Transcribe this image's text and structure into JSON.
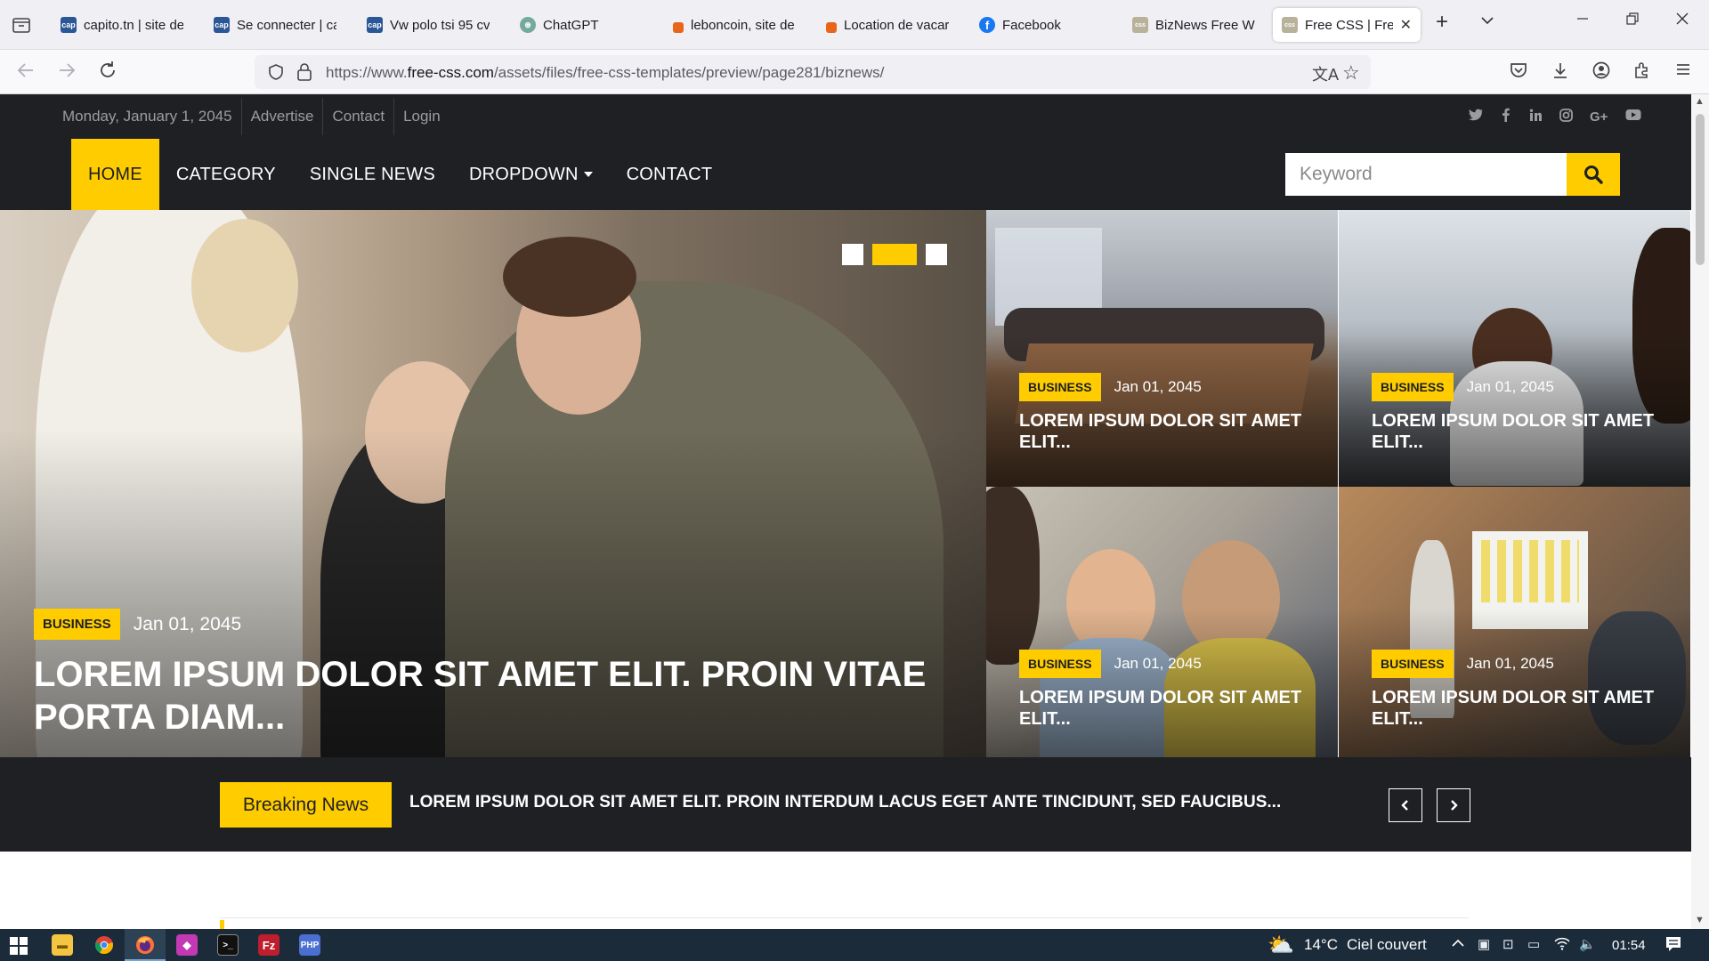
{
  "browser": {
    "tabs": [
      {
        "label": "capito.tn | site de",
        "favicon_color": "#2b5797",
        "favicon_text": "cap"
      },
      {
        "label": "Se connecter | cap",
        "favicon_color": "#2b5797",
        "favicon_text": "cap"
      },
      {
        "label": "Vw polo tsi 95 cv",
        "favicon_color": "#2b5797",
        "favicon_text": "cap"
      },
      {
        "label": "ChatGPT",
        "favicon_color": "#74aa9c",
        "favicon_text": "⊛"
      },
      {
        "label": "leboncoin, site de",
        "favicon_color": "#e8651a",
        "favicon_text": ""
      },
      {
        "label": "Location de vacar",
        "favicon_color": "#e8651a",
        "favicon_text": ""
      },
      {
        "label": "Facebook",
        "favicon_color": "#1877f2",
        "favicon_text": "f"
      },
      {
        "label": "BizNews Free Wel",
        "favicon_color": "#b9b29a",
        "favicon_text": "css"
      },
      {
        "label": "Free CSS | Free",
        "favicon_color": "#b9b29a",
        "favicon_text": "css",
        "active": true
      }
    ],
    "url_prefix": "https://www.",
    "url_domain": "free-css.com",
    "url_path": "/assets/files/free-css-templates/preview/page281/biznews/"
  },
  "site": {
    "accent": "#FFCC00",
    "dark": "#1e2024",
    "topbar": {
      "date": "Monday, January 1, 2045",
      "links": [
        "Advertise",
        "Contact",
        "Login"
      ],
      "social_icons": [
        "twitter-icon",
        "facebook-icon",
        "linkedin-icon",
        "instagram-icon",
        "google-plus-icon",
        "youtube-icon"
      ]
    },
    "nav": {
      "items": [
        "Home",
        "Category",
        "Single News",
        "Dropdown",
        "Contact"
      ],
      "active": "Home"
    },
    "search": {
      "placeholder": "Keyword"
    },
    "hero": {
      "badge": "Business",
      "date": "Jan 01, 2045",
      "title": "Lorem ipsum dolor sit amet elit. Proin vitae porta diam...",
      "slides_total": 3,
      "slide_active": 2
    },
    "cards": [
      {
        "badge": "Business",
        "date": "Jan 01, 2045",
        "title": "Lorem ipsum dolor sit amet elit..."
      },
      {
        "badge": "Business",
        "date": "Jan 01, 2045",
        "title": "Lorem ipsum dolor sit amet elit..."
      },
      {
        "badge": "Business",
        "date": "Jan 01, 2045",
        "title": "Lorem ipsum dolor sit amet elit..."
      },
      {
        "badge": "Business",
        "date": "Jan 01, 2045",
        "title": "Lorem ipsum dolor sit amet elit..."
      }
    ],
    "breaking": {
      "label": "Breaking News",
      "text": "Lorem ipsum dolor sit amet elit. Proin interdum lacus eget ante tincidunt, sed faucibus..."
    }
  },
  "taskbar": {
    "weather": "14°C",
    "weather_desc": "Ciel couvert",
    "time": "01:54"
  }
}
